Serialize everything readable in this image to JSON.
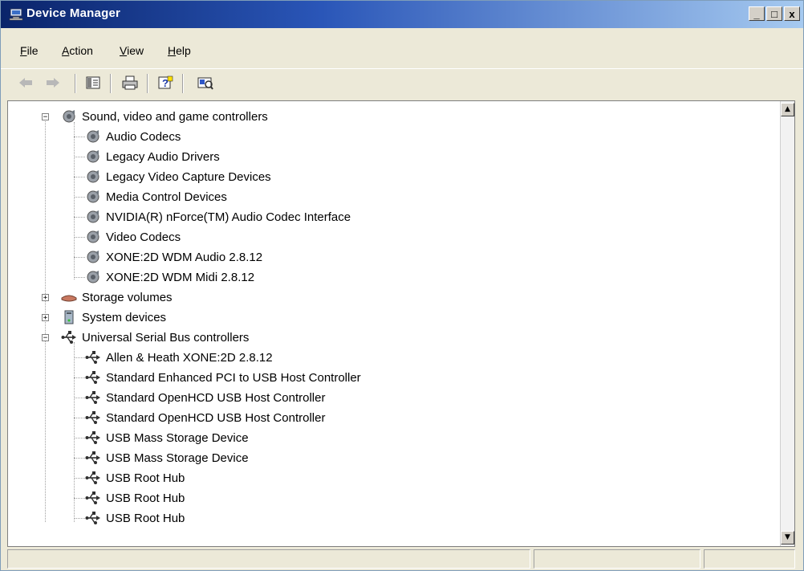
{
  "window": {
    "title": "Device Manager",
    "buttons": {
      "minimize": "_",
      "maximize": "□",
      "close": "x"
    }
  },
  "menu": [
    {
      "label": "File",
      "accel": "F",
      "rest": "ile"
    },
    {
      "label": "Action",
      "accel": "A",
      "rest": "ction"
    },
    {
      "label": "View",
      "accel": "V",
      "rest": "iew"
    },
    {
      "label": "Help",
      "accel": "H",
      "rest": "elp"
    }
  ],
  "toolbar": {
    "icons": [
      "back-arrow-icon",
      "forward-arrow-icon",
      "show-hide-console-tree-icon",
      "print-icon",
      "help-icon",
      "properties-icon"
    ]
  },
  "tree": {
    "sound": {
      "label": "Sound, video and game controllers",
      "expander": "−",
      "children": [
        "Audio Codecs",
        "Legacy Audio Drivers",
        "Legacy Video Capture Devices",
        "Media Control Devices",
        "NVIDIA(R) nForce(TM) Audio Codec Interface",
        "Video Codecs",
        "XONE:2D WDM Audio 2.8.12",
        "XONE:2D WDM Midi 2.8.12"
      ]
    },
    "storage": {
      "label": "Storage volumes",
      "expander": "+"
    },
    "system": {
      "label": "System devices",
      "expander": "+"
    },
    "usb": {
      "label": "Universal Serial Bus controllers",
      "expander": "−",
      "children": [
        "Allen & Heath XONE:2D 2.8.12",
        "Standard Enhanced PCI to USB Host Controller",
        "Standard OpenHCD USB Host Controller",
        "Standard OpenHCD USB Host Controller",
        "USB Mass Storage Device",
        "USB Mass Storage Device",
        "USB Root Hub",
        "USB Root Hub",
        "USB Root Hub"
      ]
    }
  },
  "scrollbar": {
    "up": "▲",
    "down": "▼"
  },
  "status": [
    "",
    "",
    ""
  ]
}
